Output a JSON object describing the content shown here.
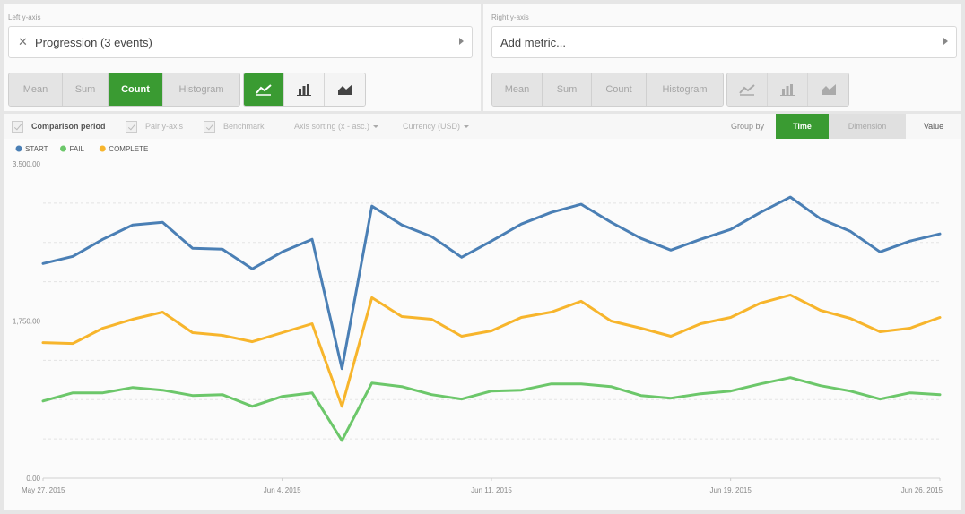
{
  "left_axis": {
    "title": "Left y-axis",
    "metric": "Progression (3 events)",
    "aggregations": [
      "Mean",
      "Sum",
      "Count",
      "Histogram"
    ],
    "active_aggregation": "Count"
  },
  "right_axis": {
    "title": "Right y-axis",
    "metric": "Add metric...",
    "aggregations": [
      "Mean",
      "Sum",
      "Count",
      "Histogram"
    ]
  },
  "options": {
    "comparison_period": "Comparison period",
    "pair_y_axis": "Pair y-axis",
    "benchmark": "Benchmark",
    "axis_sorting": "Axis sorting (x - asc.)",
    "currency": "Currency (USD)",
    "group_by_label": "Group by",
    "group_time": "Time",
    "group_dimension": "Dimension",
    "group_value": "Value"
  },
  "colors": {
    "accent": "#3a9b32",
    "start": "#4a7fb5",
    "fail": "#6cc76a",
    "complete": "#f7b52c"
  },
  "chart_data": {
    "type": "line",
    "x": [
      "May 27, 2015",
      "May 28, 2015",
      "May 29, 2015",
      "May 30, 2015",
      "May 31, 2015",
      "Jun 1, 2015",
      "Jun 2, 2015",
      "Jun 3, 2015",
      "Jun 4, 2015",
      "Jun 5, 2015",
      "Jun 6, 2015",
      "Jun 7, 2015",
      "Jun 8, 2015",
      "Jun 9, 2015",
      "Jun 10, 2015",
      "Jun 11, 2015",
      "Jun 12, 2015",
      "Jun 13, 2015",
      "Jun 14, 2015",
      "Jun 15, 2015",
      "Jun 16, 2015",
      "Jun 17, 2015",
      "Jun 18, 2015",
      "Jun 19, 2015",
      "Jun 20, 2015",
      "Jun 21, 2015",
      "Jun 22, 2015",
      "Jun 23, 2015",
      "Jun 24, 2015",
      "Jun 25, 2015",
      "Jun 26, 2015"
    ],
    "x_tick_labels": [
      "May 27, 2015",
      "Jun 4, 2015",
      "Jun 11, 2015",
      "Jun 19, 2015",
      "Jun 26, 2015"
    ],
    "x_tick_indices": [
      0,
      8,
      15,
      23,
      30
    ],
    "y_tick_labels": [
      "0.00",
      "1,750.00",
      "3,500.00"
    ],
    "ylim": [
      0,
      3500
    ],
    "grid": true,
    "legend_position": "top-left",
    "series": [
      {
        "name": "START",
        "color": "#4a7fb5",
        "values": [
          2390,
          2470,
          2660,
          2820,
          2850,
          2560,
          2550,
          2330,
          2520,
          2660,
          1220,
          3030,
          2820,
          2690,
          2460,
          2640,
          2830,
          2960,
          3050,
          2850,
          2670,
          2540,
          2660,
          2770,
          2960,
          3130,
          2890,
          2750,
          2520,
          2640,
          2720
        ]
      },
      {
        "name": "FAIL",
        "color": "#6cc76a",
        "values": [
          860,
          950,
          950,
          1010,
          980,
          920,
          930,
          800,
          910,
          950,
          420,
          1060,
          1020,
          930,
          880,
          970,
          980,
          1050,
          1050,
          1020,
          920,
          890,
          940,
          970,
          1050,
          1120,
          1030,
          970,
          880,
          950,
          930
        ]
      },
      {
        "name": "COMPLETE",
        "color": "#f7b52c",
        "values": [
          1510,
          1500,
          1670,
          1770,
          1850,
          1620,
          1590,
          1520,
          1620,
          1720,
          800,
          2010,
          1800,
          1770,
          1580,
          1640,
          1790,
          1850,
          1970,
          1750,
          1670,
          1580,
          1720,
          1790,
          1950,
          2040,
          1870,
          1780,
          1630,
          1670,
          1790
        ]
      }
    ]
  }
}
